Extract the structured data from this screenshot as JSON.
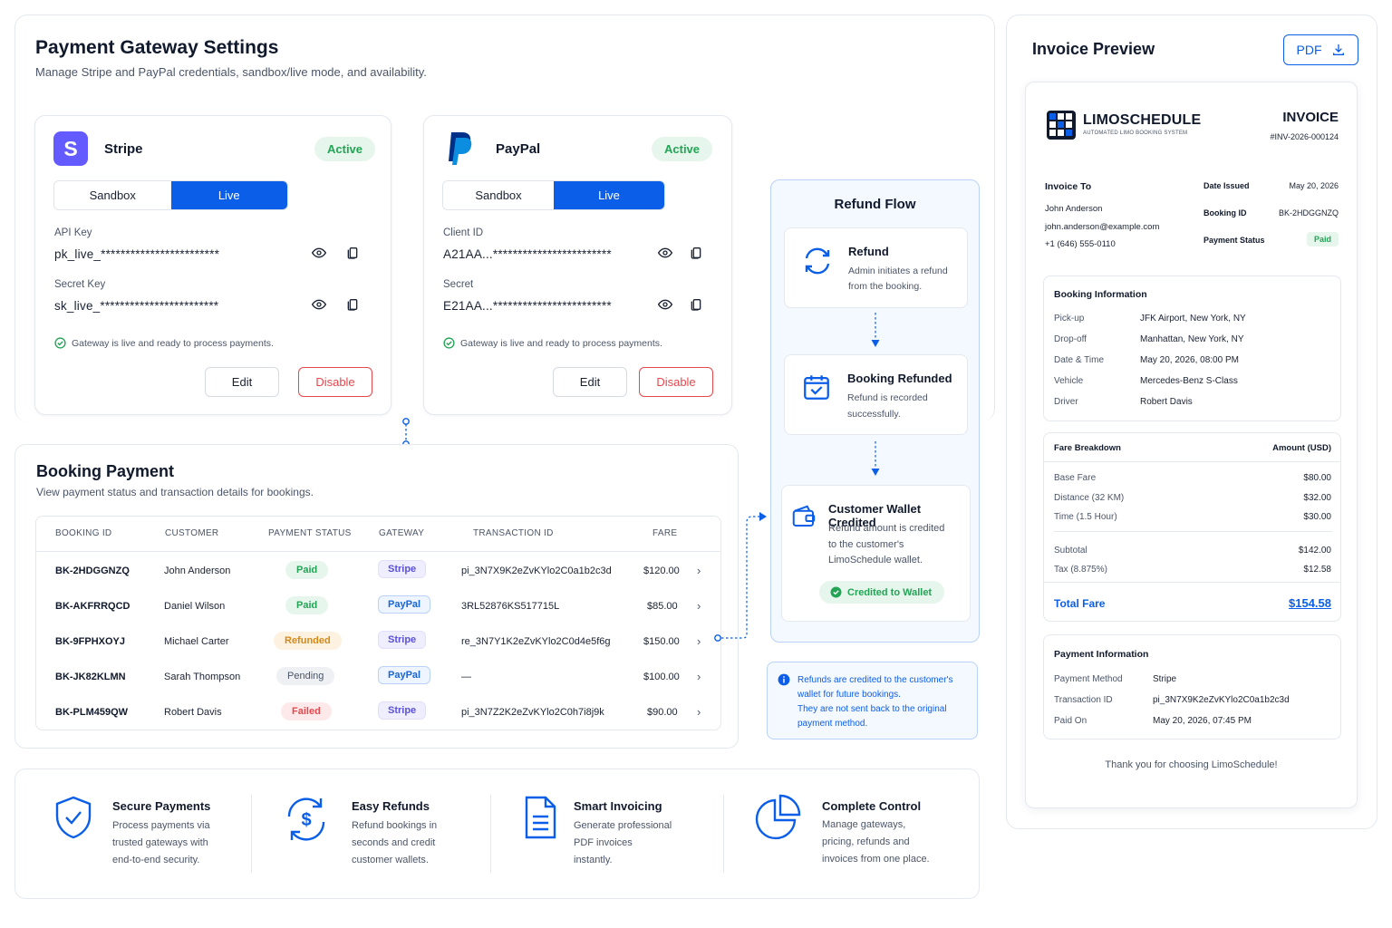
{
  "gateway_settings": {
    "title": "Payment Gateway Settings",
    "subtitle": "Manage Stripe and PayPal credentials, sandbox/live mode, and availability.",
    "stripe": {
      "name": "Stripe",
      "logo_letter": "S",
      "status": "Active",
      "mode_sandbox": "Sandbox",
      "mode_live": "Live",
      "key1_label": "API Key",
      "key1_value": "pk_live_************************",
      "key2_label": "Secret Key",
      "key2_value": "sk_live_************************",
      "note": "Gateway is live and ready to process payments.",
      "edit": "Edit",
      "disable": "Disable"
    },
    "paypal": {
      "name": "PayPal",
      "status": "Active",
      "mode_sandbox": "Sandbox",
      "mode_live": "Live",
      "key1_label": "Client ID",
      "key1_value": "A21AA...************************",
      "key2_label": "Secret",
      "key2_value": "E21AA...************************",
      "note": "Gateway is live and ready to process payments.",
      "edit": "Edit",
      "disable": "Disable"
    }
  },
  "booking_payment": {
    "title": "Booking Payment",
    "subtitle": "View payment status and transaction details for bookings.",
    "columns": [
      "BOOKING ID",
      "CUSTOMER",
      "PAYMENT STATUS",
      "GATEWAY",
      "TRANSACTION ID",
      "FARE"
    ],
    "rows": [
      {
        "id": "BK-2HDGGNZQ",
        "customer": "John Anderson",
        "status": "Paid",
        "gateway": "Stripe",
        "txn": "pi_3N7X9K2eZvKYlo2C0a1b2c3d",
        "fare": "$120.00"
      },
      {
        "id": "BK-AKFRRQCD",
        "customer": "Daniel Wilson",
        "status": "Paid",
        "gateway": "PayPal",
        "txn": "3RL52876KS517715L",
        "fare": "$85.00"
      },
      {
        "id": "BK-9FPHXOYJ",
        "customer": "Michael Carter",
        "status": "Refunded",
        "gateway": "Stripe",
        "txn": "re_3N7Y1K2eZvKYlo2C0d4e5f6g",
        "fare": "$150.00"
      },
      {
        "id": "BK-JK82KLMN",
        "customer": "Sarah Thompson",
        "status": "Pending",
        "gateway": "PayPal",
        "txn": "—",
        "fare": "$100.00"
      },
      {
        "id": "BK-PLM459QW",
        "customer": "Robert Davis",
        "status": "Failed",
        "gateway": "Stripe",
        "txn": "pi_3N7Z2K2eZvKYlo2C0h7i8j9k",
        "fare": "$90.00"
      }
    ]
  },
  "refund_flow": {
    "title": "Refund Flow",
    "steps": [
      {
        "title": "Refund",
        "desc1": "Admin initiates a refund",
        "desc2": "from the booking."
      },
      {
        "title": "Booking Refunded",
        "desc1": "Refund is recorded",
        "desc2": "successfully."
      },
      {
        "title": "Customer Wallet Credited",
        "desc1": "Refund amount is credited",
        "desc2": "to the customer's",
        "desc3": "LimoSchedule wallet."
      }
    ],
    "credited_badge": "Credited to Wallet",
    "note_line1": "Refunds are credited to the customer's",
    "note_line2": "wallet for future bookings.",
    "note_line3": "They are not sent back to the original",
    "note_line4": "payment method."
  },
  "invoice": {
    "title": "Invoice Preview",
    "pdf_label": "PDF",
    "brand": "LIMOSCHEDULE",
    "brand_tagline": "AUTOMATED LIMO BOOKING SYSTEM",
    "doc_title": "INVOICE",
    "number": "#INV-2026-000124",
    "invoice_to_label": "Invoice To",
    "customer_name": "John Anderson",
    "customer_email": "john.anderson@example.com",
    "customer_phone": "+1 (646) 555-0110",
    "date_issued_label": "Date Issued",
    "date_issued": "May 20, 2026",
    "booking_id_label": "Booking ID",
    "booking_id": "BK-2HDGGNZQ",
    "payment_status_label": "Payment Status",
    "payment_status": "Paid",
    "booking_info": {
      "title": "Booking Information",
      "rows": [
        {
          "k": "Pick-up",
          "v": "JFK Airport, New York, NY"
        },
        {
          "k": "Drop-off",
          "v": "Manhattan, New York, NY"
        },
        {
          "k": "Date & Time",
          "v": "May 20, 2026, 08:00 PM"
        },
        {
          "k": "Vehicle",
          "v": "Mercedes-Benz S-Class"
        },
        {
          "k": "Driver",
          "v": "Robert Davis"
        }
      ]
    },
    "fare": {
      "title": "Fare Breakdown",
      "amount_label": "Amount (USD)",
      "rows": [
        {
          "k": "Base Fare",
          "v": "$80.00"
        },
        {
          "k": "Distance (32 KM)",
          "v": "$32.00"
        },
        {
          "k": "Time (1.5 Hour)",
          "v": "$30.00"
        },
        {
          "k": "Subtotal",
          "v": "$142.00"
        },
        {
          "k": "Tax (8.875%)",
          "v": "$12.58"
        }
      ],
      "total_label": "Total Fare",
      "total": "$154.58"
    },
    "payment_info": {
      "title": "Payment Information",
      "rows": [
        {
          "k": "Payment Method",
          "v": "Stripe"
        },
        {
          "k": "Transaction ID",
          "v": "pi_3N7X9K2eZvKYlo2C0a1b2c3d"
        },
        {
          "k": "Paid On",
          "v": "May 20, 2026, 07:45 PM"
        }
      ]
    },
    "thanks": "Thank you for choosing LimoSchedule!"
  },
  "features": [
    {
      "title": "Secure Payments",
      "l1": "Process payments via",
      "l2": "trusted gateways with",
      "l3": "end-to-end security."
    },
    {
      "title": "Easy Refunds",
      "l1": "Refund bookings in",
      "l2": "seconds and credit",
      "l3": "customer wallets."
    },
    {
      "title": "Smart Invoicing",
      "l1": "Generate professional",
      "l2": "PDF invoices",
      "l3": "instantly."
    },
    {
      "title": "Complete Control",
      "l1": "Manage gateways,",
      "l2": "pricing, refunds and",
      "l3": "invoices from one place."
    }
  ],
  "colors": {
    "primary": "#0b5ee8",
    "success": "#23a455",
    "danger": "#e5484d",
    "warning": "#d4891a",
    "stripe": "#635bff"
  }
}
